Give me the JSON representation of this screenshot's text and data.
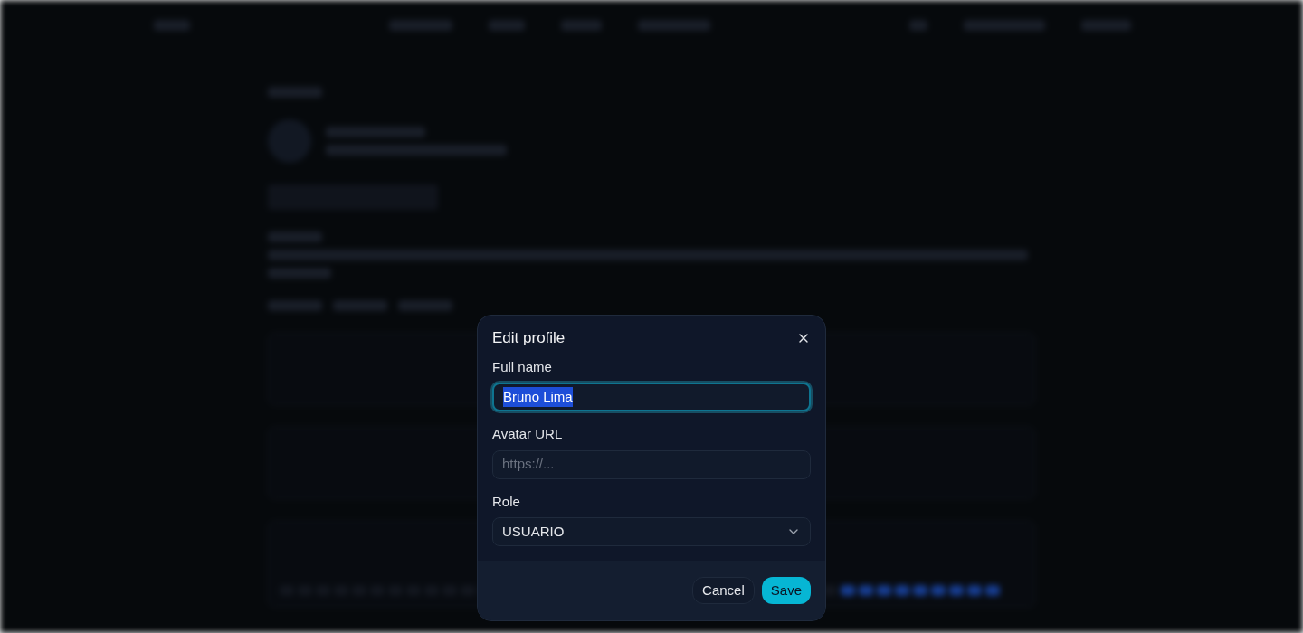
{
  "dialog": {
    "title": "Edit profile",
    "fields": [
      {
        "kind": "text",
        "label": "Full name",
        "value": "Bruno Lima",
        "focused": true,
        "text_selected": true
      },
      {
        "kind": "text",
        "label": "Avatar URL",
        "placeholder": "https://...",
        "focused": false
      },
      {
        "kind": "select",
        "label": "Role",
        "value": "USUARIO",
        "focused": false
      }
    ],
    "buttons": [
      {
        "label": "Cancel",
        "kind": "secondary"
      },
      {
        "label": "Save",
        "kind": "primary"
      }
    ]
  }
}
